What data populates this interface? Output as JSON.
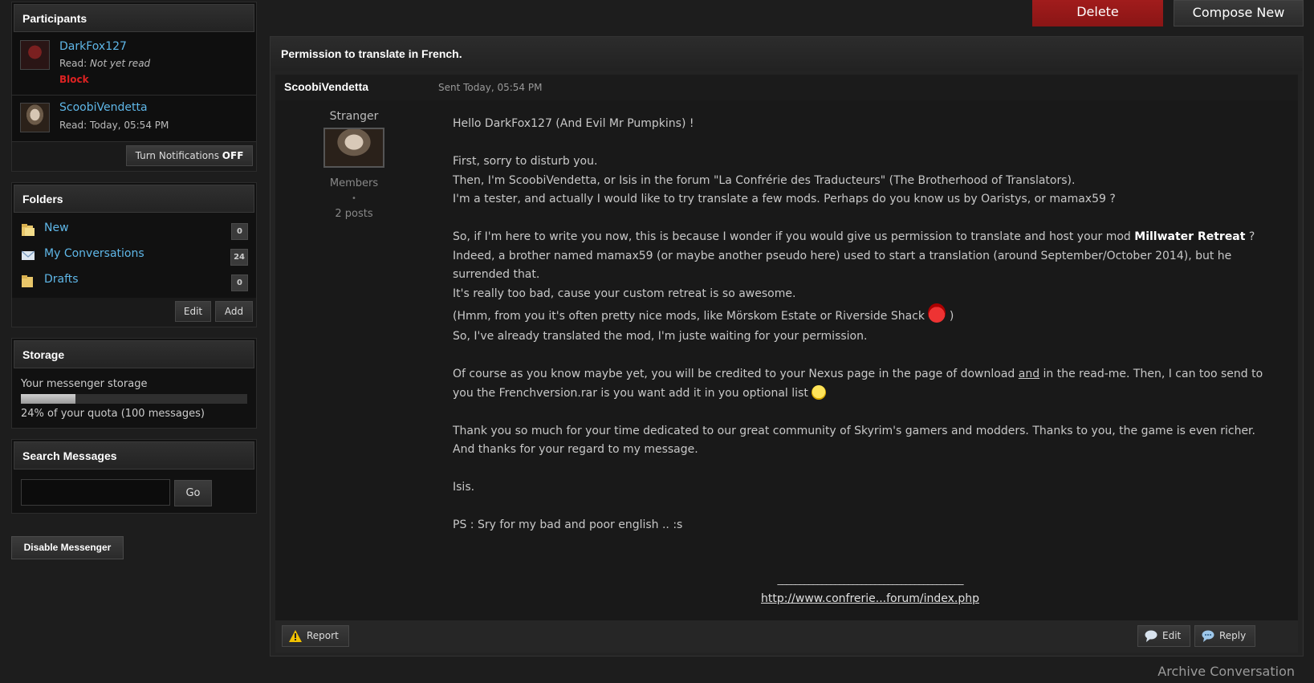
{
  "header": {
    "delete_label": "Delete",
    "compose_label": "Compose New"
  },
  "participants": {
    "title": "Participants",
    "items": [
      {
        "name": "DarkFox127",
        "read_label": "Read:",
        "read_value": "Not yet read",
        "block_label": "Block"
      },
      {
        "name": "ScoobiVendetta",
        "read_label": "Read:",
        "read_value": "Today, 05:54 PM"
      }
    ],
    "notifications_label": "Turn Notifications",
    "notifications_state": "OFF"
  },
  "folders": {
    "title": "Folders",
    "items": [
      {
        "name": "New",
        "count": "0"
      },
      {
        "name": "My Conversations",
        "count": "24"
      },
      {
        "name": "Drafts",
        "count": "0"
      }
    ],
    "edit_label": "Edit",
    "add_label": "Add"
  },
  "storage": {
    "title": "Storage",
    "label": "Your messenger storage",
    "quota_text": "24% of your quota (100 messages)",
    "percent": 24
  },
  "search": {
    "title": "Search Messages",
    "value": "",
    "go_label": "Go"
  },
  "disable_label": "Disable Messenger",
  "message": {
    "title": "Permission to translate in French.",
    "author": "ScoobiVendetta",
    "sent": "Sent Today, 05:54 PM",
    "rank": "Stranger",
    "group": "Members",
    "dot": "•",
    "posts": "2 posts",
    "body": {
      "l1": "Hello DarkFox127 (And Evil Mr Pumpkins) !",
      "l2": "First, sorry to disturb you.",
      "l3": "Then, I'm ScoobiVendetta, or Isis in the forum \"La Confrérie des Traducteurs\" (The Brotherhood of Translators).",
      "l4": "I'm a tester, and actually I would like to try translate a few mods. Perhaps do you know us by Oaristys, or mamax59 ?",
      "l5a": "So, if I'm here to write you now, this is because I wonder if you would give us permission to translate and host your mod ",
      "l5b": "Millwater Retreat",
      "l5c": " ?",
      "l6": "Indeed, a brother named mamax59 (or maybe another pseudo here) used to start a translation (around September/October 2014), but he",
      "l7": "surrended that.",
      "l8": "It's really too bad, cause your custom retreat is so awesome.",
      "l9a": "(Hmm, from you it's often pretty nice mods, like Mörskom Estate or Riverside Shack ",
      "l9b": " )",
      "l10": "So, I've already translated the mod, I'm juste waiting for your permission.",
      "l11a": "Of course as you know maybe yet, you will be credited to your Nexus page in the page of download ",
      "l11b": "and",
      "l11c": " in the read-me. Then, I can too send to",
      "l12": "you the Frenchversion.rar is you want add it in you optional list ",
      "l13": "Thank you so much for your time dedicated to our great community of Skyrim's gamers and modders. Thanks to you, the game is even richer.",
      "l14": "And thanks for your regard to my message.",
      "l15": "Isis.",
      "l16": "PS : Sry for my bad and poor english .. :s"
    },
    "signature_line": "__________________________________________",
    "signature_link": "http://www.confrerie...forum/index.php",
    "report_label": "Report",
    "edit_label": "Edit",
    "reply_label": "Reply"
  },
  "archive_label": "Archive Conversation"
}
